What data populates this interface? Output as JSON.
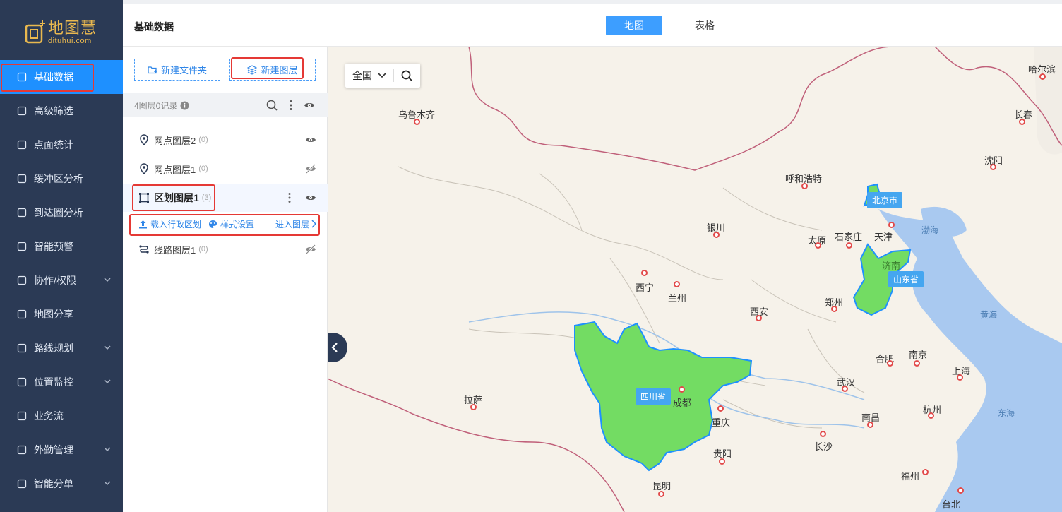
{
  "app": {
    "logo_cn": "地图慧",
    "logo_en": "dituhui.com"
  },
  "sidebar": {
    "items": [
      {
        "label": "基础数据",
        "icon": "database-icon"
      },
      {
        "label": "高级筛选",
        "icon": "filter-icon"
      },
      {
        "label": "点面统计",
        "icon": "chart-icon"
      },
      {
        "label": "缓冲区分析",
        "icon": "buffer-icon"
      },
      {
        "label": "到达圈分析",
        "icon": "reach-icon"
      },
      {
        "label": "智能预警",
        "icon": "alert-icon"
      },
      {
        "label": "协作/权限",
        "icon": "users-icon"
      },
      {
        "label": "地图分享",
        "icon": "share-icon"
      },
      {
        "label": "路线规划",
        "icon": "route-icon"
      },
      {
        "label": "位置监控",
        "icon": "location-icon"
      },
      {
        "label": "业务流",
        "icon": "flow-icon"
      },
      {
        "label": "外勤管理",
        "icon": "field-icon"
      },
      {
        "label": "智能分单",
        "icon": "dispatch-icon"
      }
    ]
  },
  "header": {
    "title": "基础数据",
    "tabs": [
      "地图",
      "表格"
    ]
  },
  "panel": {
    "new_folder": "新建文件夹",
    "new_layer": "新建图层",
    "summary": "4图层0记录",
    "layers": [
      {
        "name": "网点图层2",
        "count": "(0)"
      },
      {
        "name": "网点图层1",
        "count": "(0)"
      },
      {
        "name": "区划图层1",
        "count": "(3)"
      },
      {
        "name": "线路图层1",
        "count": "(0)"
      }
    ],
    "actions": {
      "import": "载入行政区划",
      "style": "样式设置",
      "enter": "进入图层"
    }
  },
  "map": {
    "region": "全国",
    "cities": [
      "乌鲁木齐",
      "哈尔滨",
      "长春",
      "沈阳",
      "呼和浩特",
      "北京市",
      "天津",
      "石家庄",
      "太原",
      "银川",
      "济南",
      "西宁",
      "兰州",
      "郑州",
      "西安",
      "合肥",
      "南京",
      "上海",
      "武汉",
      "拉萨",
      "成都",
      "重庆",
      "杭州",
      "南昌",
      "长沙",
      "贵阳",
      "福州",
      "昆明",
      "台北"
    ],
    "seas": [
      "渤海",
      "黄海",
      "东海"
    ],
    "provinces": [
      "北京市",
      "山东省",
      "四川省"
    ]
  }
}
